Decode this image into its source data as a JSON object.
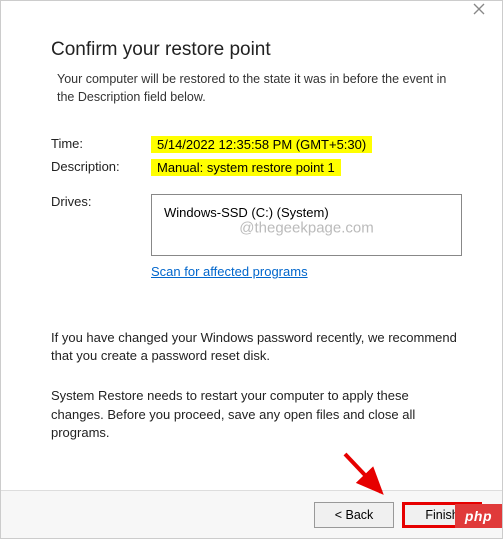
{
  "heading": "Confirm your restore point",
  "subtext": "Your computer will be restored to the state it was in before the event in the Description field below.",
  "labels": {
    "time": "Time:",
    "description": "Description:",
    "drives": "Drives:"
  },
  "values": {
    "time": "5/14/2022 12:35:58 PM (GMT+5:30)",
    "description": "Manual: system restore point 1",
    "drive": "Windows-SSD (C:) (System)"
  },
  "scan_link": "Scan for affected programs",
  "info1": "If you have changed your Windows password recently, we recommend that you create a password reset disk.",
  "info2": "System Restore needs to restart your computer to apply these changes. Before you proceed, save any open files and close all programs.",
  "buttons": {
    "back": "< Back",
    "finish": "Finish"
  },
  "watermark": "@thegeekpage.com",
  "badge": "php"
}
